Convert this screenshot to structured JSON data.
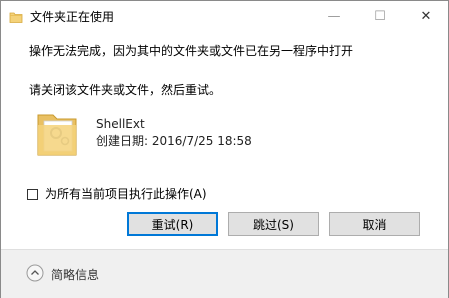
{
  "window": {
    "title": "文件夹正在使用",
    "min_symbol": "—",
    "max_symbol": "☐",
    "close_symbol": "✕"
  },
  "message": {
    "line1": "操作无法完成，因为其中的文件夹或文件已在另一程序中打开",
    "line2": "请关闭该文件夹或文件，然后重试。"
  },
  "file": {
    "icon": "folder-icon",
    "name": "ShellExt",
    "created": "创建日期: 2016/7/25 18:58"
  },
  "apply_all": {
    "label": "为所有当前项目执行此操作(A)",
    "checked": false
  },
  "buttons": {
    "retry": "重试(R)",
    "skip": "跳过(S)",
    "cancel": "取消"
  },
  "footer": {
    "details_label": "简略信息"
  },
  "colors": {
    "accent": "#0078d7",
    "button_bg": "#e1e1e1",
    "footer_bg": "#f0f0f0",
    "folder": "#f4d27a"
  }
}
